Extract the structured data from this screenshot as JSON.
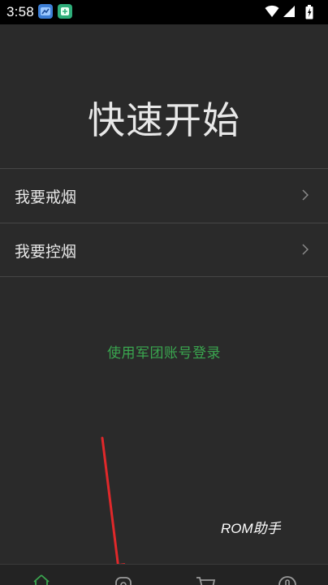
{
  "status_bar": {
    "time": "3:58",
    "notifications": [
      "app-notification-icon",
      "app-notification-icon"
    ],
    "system_icons": [
      "wifi-icon",
      "signal-icon",
      "battery-charging-icon"
    ]
  },
  "page": {
    "title": "快速开始"
  },
  "menu": {
    "items": [
      {
        "label": "我要戒烟",
        "icon": "chevron-right-icon"
      },
      {
        "label": "我要控烟",
        "icon": "chevron-right-icon"
      }
    ]
  },
  "login": {
    "link_text": "使用军团账号登录"
  },
  "watermark": {
    "text": "ROM助手"
  },
  "bottom_nav": {
    "tabs": [
      {
        "icon": "home-icon"
      },
      {
        "icon": "discover-icon"
      },
      {
        "icon": "cart-icon"
      },
      {
        "icon": "profile-icon"
      }
    ]
  },
  "colors": {
    "background": "#2a2a2a",
    "status_bar": "#000000",
    "text_primary": "#e6e6e6",
    "divider": "#464646",
    "accent_green": "#3aa64f",
    "annotation_red": "#e0282a"
  }
}
